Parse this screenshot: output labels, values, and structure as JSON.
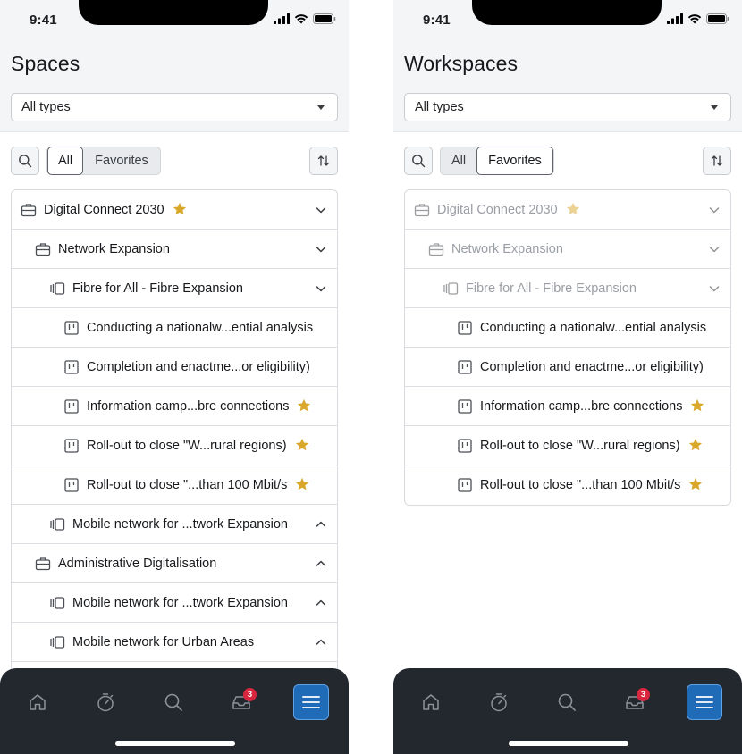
{
  "status": {
    "time": "9:41"
  },
  "left": {
    "title": "Spaces",
    "type_filter": "All types",
    "segments": [
      "All",
      "Favorites"
    ],
    "active_segment": "All",
    "tree": [
      {
        "label": "Digital Connect 2030",
        "icon": "briefcase-icon",
        "level": 0,
        "star": true,
        "chevron": "down"
      },
      {
        "label": "Network Expansion",
        "icon": "briefcase-icon",
        "level": 1,
        "star": false,
        "chevron": "down"
      },
      {
        "label": "Fibre for All - Fibre Expansion",
        "icon": "stack-icon",
        "level": 2,
        "star": false,
        "chevron": "down"
      },
      {
        "label": "Conducting a nationalw...ential analysis",
        "icon": "board-icon",
        "level": 3,
        "star": false,
        "chevron": "none"
      },
      {
        "label": "Completion and enactme...or eligibility)",
        "icon": "board-icon",
        "level": 3,
        "star": false,
        "chevron": "none"
      },
      {
        "label": "Information camp...bre connections",
        "icon": "board-icon",
        "level": 3,
        "star": true,
        "chevron": "none"
      },
      {
        "label": "Roll-out to close \"W...rural regions)",
        "icon": "board-icon",
        "level": 3,
        "star": true,
        "chevron": "none"
      },
      {
        "label": "Roll-out to close \"...than 100 Mbit/s",
        "icon": "board-icon",
        "level": 3,
        "star": true,
        "chevron": "none"
      },
      {
        "label": "Mobile network for ...twork Expansion",
        "icon": "stack-icon",
        "level": 2,
        "star": false,
        "chevron": "up"
      },
      {
        "label": "Administrative Digitalisation",
        "icon": "briefcase-icon",
        "level": 1,
        "star": false,
        "chevron": "up"
      },
      {
        "label": "Mobile network for ...twork Expansion",
        "icon": "stack-icon",
        "level": 2,
        "star": false,
        "chevron": "up"
      },
      {
        "label": "Mobile network for Urban Areas",
        "icon": "stack-icon",
        "level": 2,
        "star": false,
        "chevron": "up"
      }
    ]
  },
  "right": {
    "title": "Workspaces",
    "type_filter": "All types",
    "segments": [
      "All",
      "Favorites"
    ],
    "active_segment": "Favorites",
    "tree": [
      {
        "label": "Digital Connect 2030",
        "icon": "briefcase-icon",
        "level": 0,
        "star": true,
        "chevron": "down",
        "dim": true
      },
      {
        "label": "Network Expansion",
        "icon": "briefcase-icon",
        "level": 1,
        "star": false,
        "chevron": "down",
        "dim": true
      },
      {
        "label": "Fibre for All - Fibre Expansion",
        "icon": "stack-icon",
        "level": 2,
        "star": false,
        "chevron": "down",
        "dim": true
      },
      {
        "label": "Conducting a nationalw...ential analysis",
        "icon": "board-icon",
        "level": 3,
        "star": false,
        "chevron": "none"
      },
      {
        "label": "Completion and enactme...or eligibility)",
        "icon": "board-icon",
        "level": 3,
        "star": false,
        "chevron": "none"
      },
      {
        "label": "Information camp...bre connections",
        "icon": "board-icon",
        "level": 3,
        "star": true,
        "chevron": "none"
      },
      {
        "label": "Roll-out to close \"W...rural regions)",
        "icon": "board-icon",
        "level": 3,
        "star": true,
        "chevron": "none"
      },
      {
        "label": "Roll-out to close \"...than 100 Mbit/s",
        "icon": "board-icon",
        "level": 3,
        "star": true,
        "chevron": "none"
      }
    ]
  },
  "tabbar": {
    "items": [
      "home-icon",
      "timer-icon",
      "search-icon",
      "inbox-icon",
      "menu-icon"
    ],
    "inbox_badge": "3",
    "active": "menu-icon"
  },
  "colors": {
    "star": "#d9a72a",
    "menu_active": "#1f6bb8",
    "badge": "#d7263d",
    "tabbar": "#23272e"
  }
}
